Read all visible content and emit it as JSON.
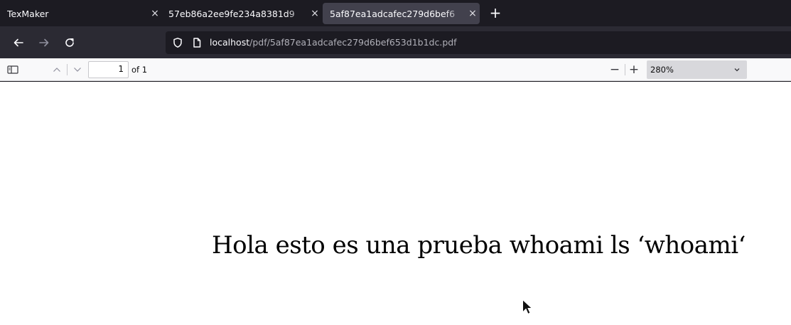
{
  "tabs": [
    {
      "title": "TexMaker",
      "close": "×",
      "active": false
    },
    {
      "title": "57eb86a2ee9fe234a8381d9",
      "close": "×",
      "active": false
    },
    {
      "title": "5af87ea1adcafec279d6bef6",
      "close": "×",
      "active": true
    }
  ],
  "new_tab_label": "+",
  "url": {
    "host": "localhost",
    "path": "/pdf/5af87ea1adcafec279d6bef653d1b1dc.pdf"
  },
  "pdf_toolbar": {
    "page_number": "1",
    "page_count_label": "of 1",
    "zoom_out_label": "−",
    "zoom_in_label": "+",
    "zoom_value": "280%"
  },
  "document": {
    "text": "Hola esto es una prueba whoami ls ‘whoami‘"
  },
  "icons": {
    "back": "arrow-left-icon",
    "forward": "arrow-right-icon",
    "reload": "reload-icon",
    "tracking": "shield-icon",
    "page": "page-icon",
    "sidebar": "sidebar-toggle-icon",
    "prev": "chevron-up-icon",
    "next": "chevron-down-icon"
  },
  "colors": {
    "chrome_dark": "#1c1b22",
    "toolbar": "#2b2a33",
    "active_tab": "#42414d",
    "pdf_toolbar": "#f9f9fa"
  }
}
